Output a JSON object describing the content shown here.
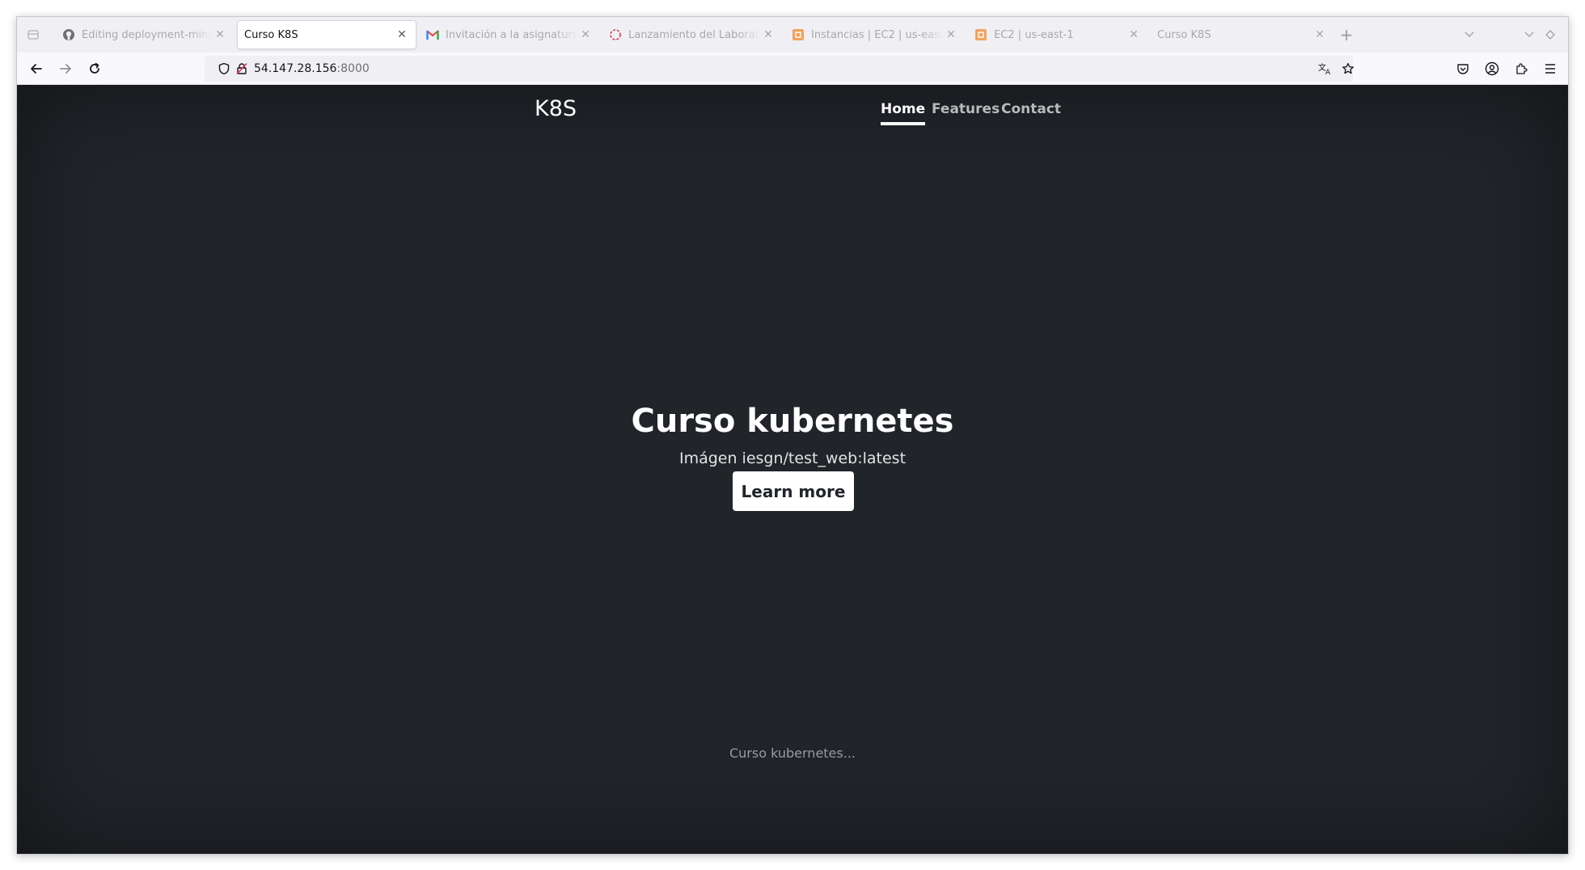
{
  "browser": {
    "tabs": [
      {
        "title": "Editing deployment-minikube",
        "favicon": "github-icon",
        "active": false
      },
      {
        "title": "Curso K8S",
        "favicon": "none",
        "active": true
      },
      {
        "title": "Invitación a la asignatura",
        "favicon": "gmail-icon",
        "active": false
      },
      {
        "title": "Lanzamiento del Laboratorio",
        "favicon": "loading-spinner-icon",
        "active": false
      },
      {
        "title": "Instancias | EC2 | us-east-1",
        "favicon": "aws-icon",
        "active": false
      },
      {
        "title": "EC2 | us-east-1",
        "favicon": "aws-icon",
        "active": false
      },
      {
        "title": "Curso K8S",
        "favicon": "none",
        "active": false
      }
    ],
    "url": {
      "host": "54.147.28.156",
      "port": ":8000"
    },
    "colors": {
      "chrome": "#f0f0f4",
      "page_bg": "#212429"
    }
  },
  "site": {
    "brand": "K8S",
    "nav": [
      {
        "label": "Home",
        "active": true
      },
      {
        "label": "Features",
        "active": false
      },
      {
        "label": "Contact",
        "active": false
      }
    ],
    "hero": {
      "title": "Curso kubernetes",
      "subtitle": "Imágen iesgn/test_web:latest",
      "button": "Learn more"
    },
    "footer": "Curso kubernetes..."
  }
}
